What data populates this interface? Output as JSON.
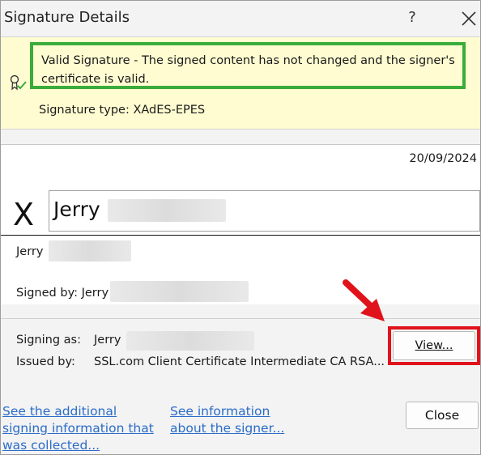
{
  "dialog": {
    "title": "Signature Details",
    "help_label": "?"
  },
  "banner": {
    "status_text": "Valid Signature - The signed content has not changed and the signer's certificate is valid.",
    "signature_type": "Signature type: XAdES-EPES",
    "status_color": "#3aac3a",
    "background_color": "#fffcd1"
  },
  "signature": {
    "date": "20/09/2024",
    "x_mark": "X",
    "signed_name": "Jerry",
    "signer_name": "Jerry",
    "signed_by": "Signed by: Jerry"
  },
  "certificate": {
    "signing_as_label": "Signing as:",
    "signing_as_value": "Jerry",
    "issued_by_label": "Issued by:",
    "issued_by_value": "SSL.com Client Certificate Intermediate CA RSA..."
  },
  "buttons": {
    "view_label": "View...",
    "close_label": "Close",
    "highlight_color": "#e0131c"
  },
  "links": {
    "additional_info": "See the additional signing information that was collected...",
    "signer_info": "See information about the signer..."
  },
  "icons": {
    "close": "close-x-icon",
    "badge": "signature-badge-icon",
    "annotation": "red-arrow-icon"
  }
}
